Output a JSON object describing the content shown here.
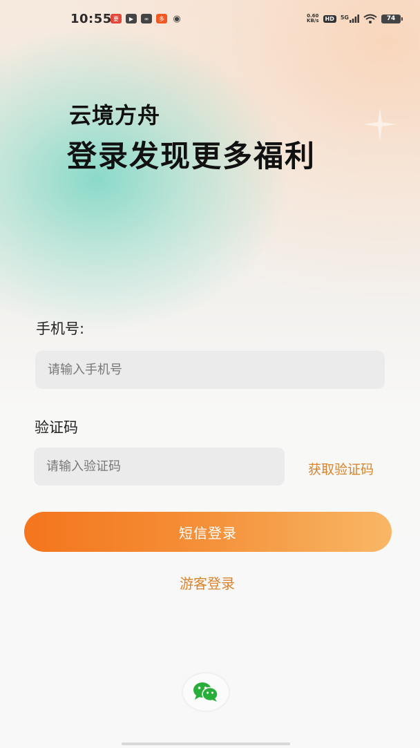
{
  "status_bar": {
    "time": "10:55",
    "net_speed_value": "0.60",
    "net_speed_unit": "KB/s",
    "hd_badge": "HD",
    "signal_label": "5G",
    "battery": "74",
    "notification_icons": [
      "news-app-icon",
      "video-app-icon",
      "link-app-icon",
      "shopping-app-icon",
      "weibo-icon"
    ]
  },
  "header": {
    "app_name": "云境方舟",
    "headline": "登录发现更多福利"
  },
  "form": {
    "phone_label": "手机号:",
    "phone_placeholder": "请输入手机号",
    "phone_value": "",
    "code_label": "验证码",
    "code_placeholder": "请输入验证码",
    "code_value": "",
    "get_code_label": "获取验证码",
    "login_button": "短信登录",
    "guest_login": "游客登录"
  },
  "social_login": {
    "icon": "wechat-icon"
  },
  "colors": {
    "accent": "#d9832c",
    "button_start": "#f4751c",
    "button_end": "#f8b766",
    "wechat_green": "#2aae3b"
  }
}
